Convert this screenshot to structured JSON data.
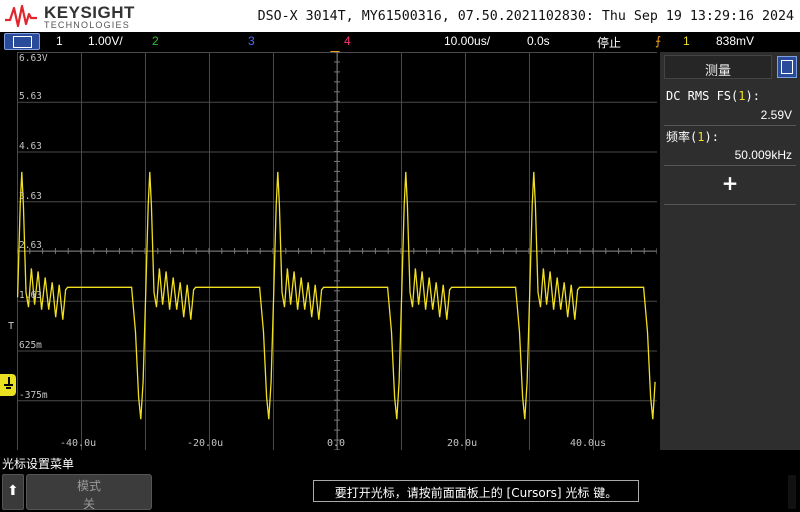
{
  "header": {
    "brand": "KEYSIGHT",
    "brand_sub": "TECHNOLOGIES",
    "instrument_title": "DSO-X 3014T, MY61500316, 07.50.2021102830: Thu Sep 19 13:29:16 2024"
  },
  "statusbar": {
    "ch1_num": "1",
    "ch1_scale": "1.00V/",
    "ch2_num": "2",
    "ch3_num": "3",
    "ch4_num": "4",
    "timebase": "10.00us/",
    "delay": "0.0s",
    "run_state": "停止",
    "trigger_symbol": "⨍",
    "trigger_source": "1",
    "trigger_level": "838mV",
    "colors": {
      "ch1": "#f0e020",
      "ch2": "#30c030",
      "ch3": "#4a6cff",
      "ch4": "#ff3070",
      "trigger": "#f0a020"
    }
  },
  "screen": {
    "y_labels": [
      "6.63V",
      "5.63",
      "4.63",
      "3.63",
      "2.63",
      "1.63",
      "625m",
      "-375m"
    ],
    "x_labels": [
      "-40.0u",
      "-20.0u",
      "0.0",
      "20.0u",
      "40.0us"
    ],
    "trigger_level_marker": "T",
    "trace_color": "#f0e020"
  },
  "chart_data": {
    "type": "line",
    "title": "",
    "xlabel": "",
    "ylabel": "",
    "x_unit": "s",
    "y_unit": "V",
    "xlim": [
      -5e-05,
      5e-05
    ],
    "ylim": [
      -0.87,
      7.13
    ],
    "grid": true,
    "series": [
      {
        "name": "1",
        "frequency_hz": 50009,
        "period_s": 2e-05,
        "points": [
          [
            0.0,
            2.4
          ],
          [
            0.62,
            1.5
          ],
          [
            1.1,
            0.2
          ],
          [
            1.45,
            -0.25
          ],
          [
            1.8,
            0.5
          ],
          [
            2.2,
            2.2
          ],
          [
            2.6,
            4.05
          ],
          [
            2.85,
            4.72
          ],
          [
            3.1,
            4.05
          ],
          [
            3.5,
            2.3
          ],
          [
            3.9,
            2.0
          ],
          [
            4.35,
            2.78
          ],
          [
            4.85,
            2.05
          ],
          [
            5.4,
            2.72
          ],
          [
            5.95,
            1.95
          ],
          [
            6.5,
            2.6
          ],
          [
            7.05,
            1.95
          ],
          [
            7.6,
            2.5
          ],
          [
            8.15,
            1.8
          ],
          [
            8.7,
            2.45
          ],
          [
            9.25,
            1.75
          ],
          [
            9.7,
            2.35
          ],
          [
            10.0,
            2.4
          ]
        ]
      }
    ],
    "measurements": [
      {
        "label": "DC RMS FS",
        "channel": "1",
        "value": "2.59V"
      },
      {
        "label": "频率",
        "channel": "1",
        "value": "50.009kHz"
      }
    ]
  },
  "sidepanel": {
    "title": "测量",
    "m1_label": "DC RMS FS",
    "m1_channel": "1",
    "m1_value": "2.59V",
    "m2_label": "频率",
    "m2_channel": "1",
    "m2_value": "50.009kHz",
    "add_label": "+"
  },
  "softkeys": {
    "menu_title": "光标设置菜单",
    "back_icon": "up-arrow-icon",
    "mode_label": "模式",
    "mode_value": "关",
    "hint": "要打开光标，请按前面面板上的 [Cursors] 光标 键。"
  }
}
